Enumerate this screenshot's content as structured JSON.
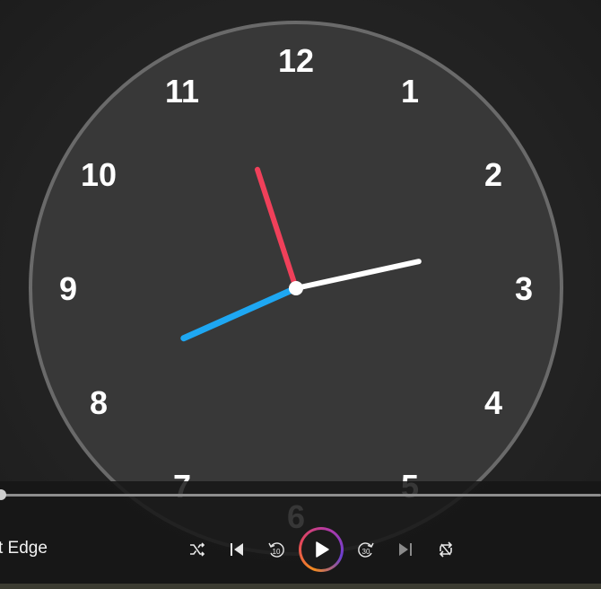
{
  "clock": {
    "numerals": [
      "12",
      "1",
      "2",
      "3",
      "4",
      "5",
      "6",
      "7",
      "8",
      "9",
      "10",
      "11"
    ],
    "time_shown": "8:12:57",
    "colors": {
      "face": "#383838",
      "rim": "#6a6a6a",
      "hour_hand": "#1ea7f2",
      "minute_hand": "#ffffff",
      "second_hand": "#f0405a",
      "center_dot": "#ffffff"
    }
  },
  "player": {
    "title": "t Edge",
    "seek_progress": 0,
    "controls": {
      "shuffle": "shuffle-icon",
      "previous": "previous-track-icon",
      "rewind_label": "10",
      "play": "play-icon",
      "forward_label": "30",
      "next": "next-track-icon",
      "repeat": "repeat-icon"
    }
  }
}
